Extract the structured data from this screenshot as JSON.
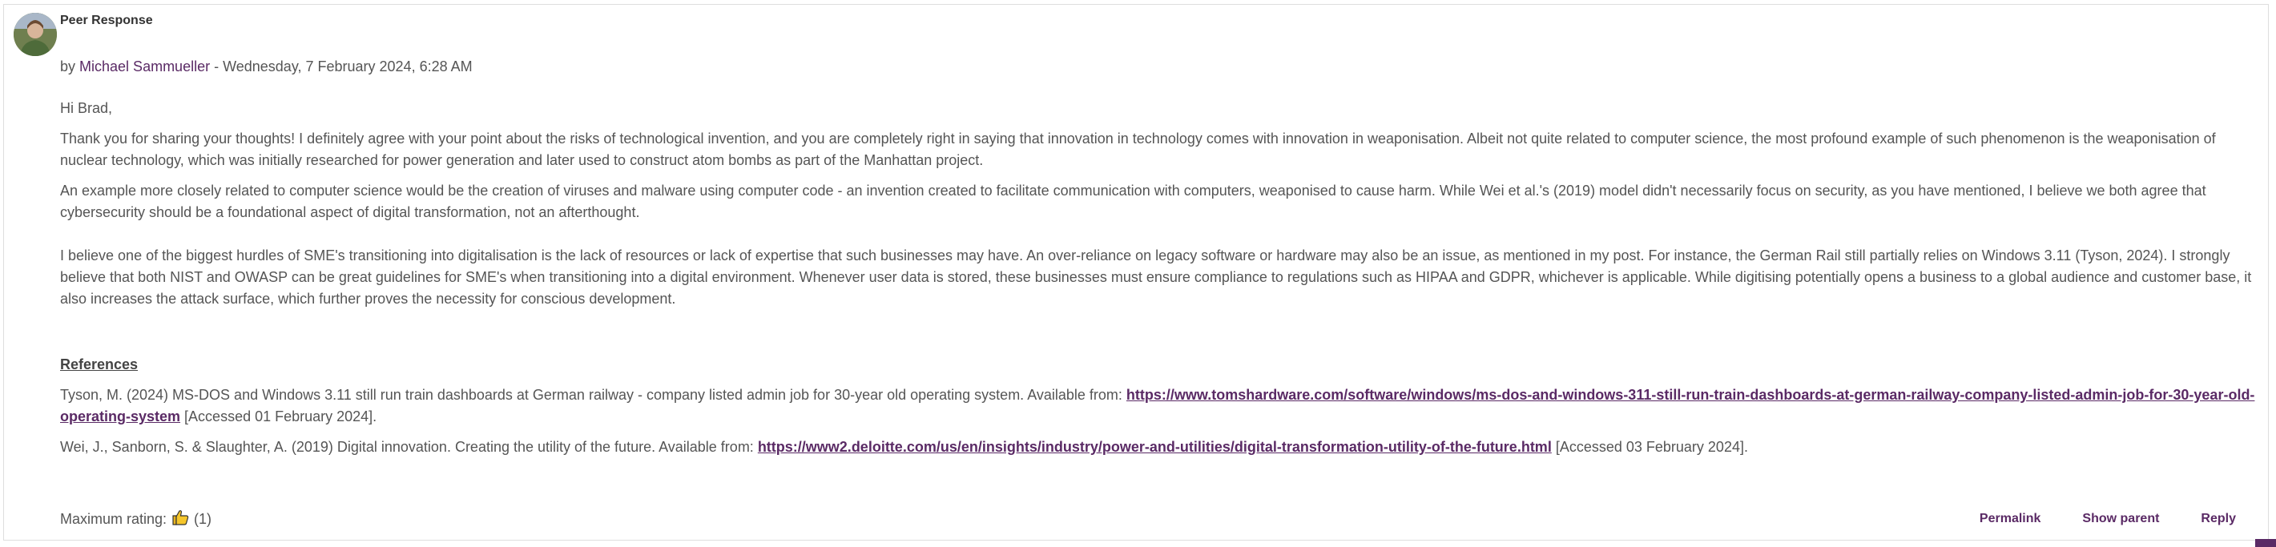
{
  "post": {
    "subject": "Peer Response",
    "by_prefix": "by",
    "author": "Michael Sammueller",
    "date_sep": " - Wednesday, 7 February 2024, 6:28 AM",
    "greeting": "Hi Brad,",
    "para1": "Thank you for sharing your thoughts! I definitely agree with your point about the risks of technological invention, and you are completely right in saying that innovation in technology comes with innovation in weaponisation. Albeit not quite related to computer science, the most profound example of such phenomenon is the weaponisation of nuclear technology, which was initially researched for power generation and later used to construct atom bombs as part of the Manhattan project.",
    "para2": "An example more closely related to computer science would be the creation of viruses and malware using computer code - an invention created to facilitate communication with computers, weaponised to cause harm. While Wei et al.'s (2019) model didn't necessarily focus on security, as you have mentioned, I believe we both agree that cybersecurity should be a foundational aspect of digital transformation, not an afterthought.",
    "para3": "I believe one of the biggest hurdles of SME's transitioning into digitalisation is the lack of resources or lack of expertise that such businesses may have. An over-reliance on legacy software or hardware may also be an issue, as mentioned in my post. For instance, the German Rail still partially relies on Windows 3.11 (Tyson, 2024). I strongly believe that both NIST and OWASP can be great guidelines for SME's when transitioning into a digital environment. Whenever user data is stored, these businesses must ensure compliance to regulations such as HIPAA and GDPR, whichever is applicable. While digitising potentially opens a business to a global audience and customer base, it also increases the attack surface, which further proves the necessity for conscious development.",
    "references_heading": "References",
    "ref1_text": "Tyson, M. (2024) MS-DOS and Windows 3.11 still run train dashboards at German railway - company listed admin job for 30-year old operating system. Available from: ",
    "ref1_link": "https://www.tomshardware.com/software/windows/ms-dos-and-windows-311-still-run-train-dashboards-at-german-railway-company-listed-admin-job-for-30-year-old-operating-system",
    "ref1_accessed": " [Accessed 01 February 2024].",
    "ref2_text": "Wei, J., Sanborn, S. & Slaughter, A. (2019) Digital innovation. Creating the utility of the future. Available from: ",
    "ref2_link": "https://www2.deloitte.com/us/en/insights/industry/power-and-utilities/digital-transformation-utility-of-the-future.html",
    "ref2_accessed": " [Accessed 03 February 2024].",
    "rating_label": "Maximum rating:",
    "rating_count": "(1)"
  },
  "commands": {
    "permalink": "Permalink",
    "show_parent": "Show parent",
    "reply": "Reply"
  },
  "colors": {
    "accent": "#5a2a65",
    "text": "#555555",
    "border": "#dedede"
  },
  "icons": {
    "rating": "thumbs-up-icon"
  }
}
